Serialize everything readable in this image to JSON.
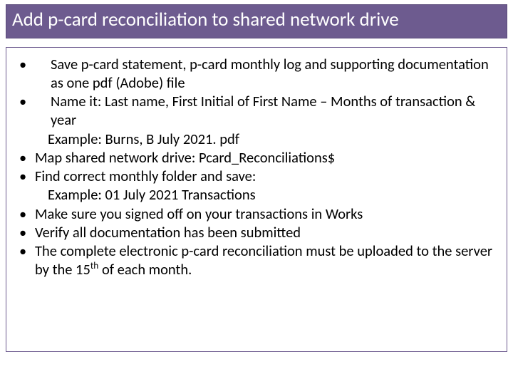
{
  "title": "Add p-card reconciliation to shared network drive",
  "bullets": [
    {
      "text": "Save p-card statement, p-card monthly log and supporting documentation as one pdf (Adobe) file",
      "indented": true
    },
    {
      "text": "Name it: Last name, First Initial of First Name – Months of transaction & year",
      "indented": true,
      "sub": "Example: Burns, B July 2021. pdf"
    },
    {
      "text": "Map shared network drive:  Pcard_Reconciliations$",
      "indented": false
    },
    {
      "text": "Find correct monthly folder and save:",
      "indented": false,
      "sub": "Example: 01 July 2021 Transactions"
    },
    {
      "text": "Make sure you signed off on your transactions in Works",
      "indented": false
    },
    {
      "text": "Verify all documentation has been submitted",
      "indented": false
    },
    {
      "text_html": "The complete electronic p-card reconciliation must be uploaded to the server by the 15<span class=\"sup\">th</span> of each month.",
      "indented": false
    }
  ]
}
